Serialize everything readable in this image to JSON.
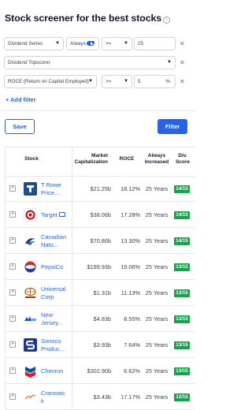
{
  "title": "Stock screener for the best stocks",
  "filters": [
    {
      "field": "Dividend Series",
      "mode": "Always",
      "operator": ">=",
      "value": "25"
    },
    {
      "field": "Dividend Topscorer"
    },
    {
      "field": "ROCE (Return on Capital Employed)",
      "operator": ">=",
      "value": "5",
      "unit": "%"
    }
  ],
  "add_filter": "+ Add filter",
  "save_label": "Save",
  "filter_label": "Filter",
  "table": {
    "headers": {
      "stock": "Stock",
      "cap_1": "Market",
      "cap_2": "Capitalization",
      "roce": "ROCE",
      "inc_1": "Always",
      "inc_2": "Increased",
      "score_1": "Div.",
      "score_2": "Score"
    },
    "rows": [
      {
        "name_1": "T Rowe",
        "name_2": "Price...",
        "cap": "$21.25b",
        "roce": "18.12%",
        "inc": "25 Years",
        "score": "14/15"
      },
      {
        "name_1": "Target",
        "name_2": "",
        "cap": "$38.06b",
        "roce": "17.28%",
        "inc": "25 Years",
        "score": "14/15"
      },
      {
        "name_1": "Canadian",
        "name_2": "Natu...",
        "cap": "$70.86b",
        "roce": "13.30%",
        "inc": "25 Years",
        "score": "14/15"
      },
      {
        "name_1": "PepsiCo",
        "name_2": "",
        "cap": "$199.93b",
        "roce": "19.06%",
        "inc": "25 Years",
        "score": "13/15"
      },
      {
        "name_1": "Universal",
        "name_2": "Corp",
        "cap": "$1.31b",
        "roce": "11.13%",
        "inc": "25 Years",
        "score": "13/15"
      },
      {
        "name_1": "New",
        "name_2": "Jersey...",
        "cap": "$4.83b",
        "roce": "8.55%",
        "inc": "25 Years",
        "score": "13/15"
      },
      {
        "name_1": "Sonoco",
        "name_2": "Produc...",
        "cap": "$3.93b",
        "roce": "7.64%",
        "inc": "25 Years",
        "score": "13/15"
      },
      {
        "name_1": "Chevron",
        "name_2": "",
        "cap": "$302.90b",
        "roce": "6.62%",
        "inc": "25 Years",
        "score": "13/15"
      },
      {
        "name_1": "Cranswic",
        "name_2": "k",
        "cap": "$3.43b",
        "roce": "17.17%",
        "inc": "25 Years",
        "score": "12/15"
      }
    ]
  },
  "colors": {
    "accent": "#2563eb",
    "score_green": "#16a34a"
  }
}
